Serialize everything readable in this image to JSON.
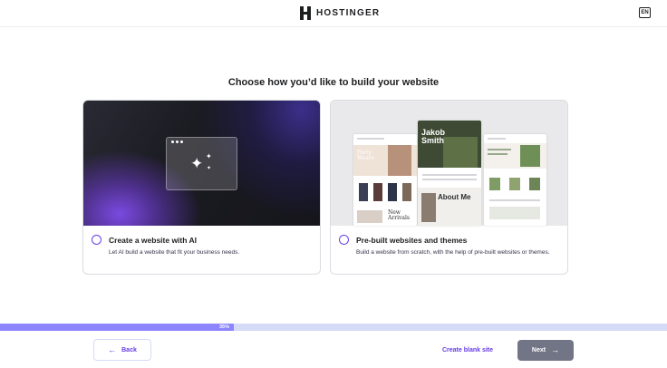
{
  "header": {
    "brand": "HOSTINGER",
    "language": "EN"
  },
  "main": {
    "heading": "Choose how you’d like to build your website",
    "options": [
      {
        "title": "Create a website with AI",
        "description": "Let AI build a website that fit your business needs.",
        "selected": false
      },
      {
        "title": "Pre-built websites and themes",
        "description": "Build a website from scratch, with the help of pre-built websites or themes.",
        "selected": false,
        "preview_texts": {
          "party": "Party Wears",
          "name": "Jakob Smith",
          "about": "About Me",
          "arrivals": "New Arrivals"
        }
      }
    ]
  },
  "progress": {
    "percent": 35,
    "label": "35%"
  },
  "footer": {
    "back_label": "Back",
    "blank_label": "Create blank site",
    "next_label": "Next"
  },
  "colors": {
    "accent": "#673de6",
    "progress_fill": "#8c85ff",
    "progress_track": "#d5dbf6",
    "next_button": "#727586"
  },
  "icons": {
    "logo": "hostinger-logo-icon",
    "back": "arrow-left-icon",
    "next": "arrow-right-icon",
    "ai": "sparkles-icon"
  }
}
